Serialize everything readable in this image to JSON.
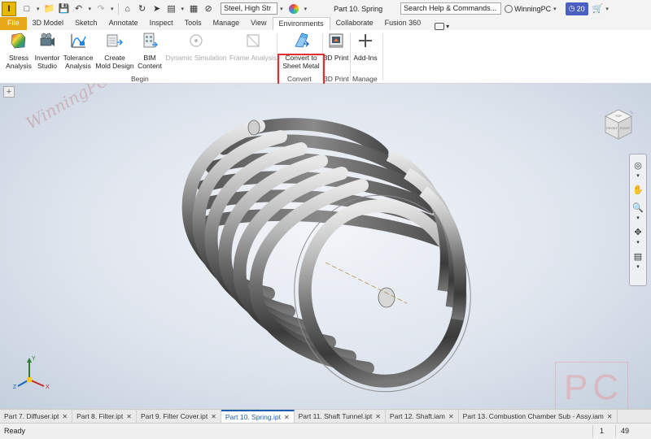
{
  "quick_access": {
    "material": "Steel, High Str",
    "document_title": "Part 10. Spring",
    "search_placeholder": "Search Help & Commands...",
    "user": "WinningPC",
    "clock_count": "20"
  },
  "tabs": [
    "File",
    "3D Model",
    "Sketch",
    "Annotate",
    "Inspect",
    "Tools",
    "Manage",
    "View",
    "Environments",
    "Collaborate",
    "Fusion 360"
  ],
  "active_tab": "Environments",
  "ribbon": {
    "stress_analysis": [
      "Stress",
      "Analysis"
    ],
    "inventor_studio": [
      "Inventor",
      "Studio"
    ],
    "tolerance_analysis": [
      "Tolerance",
      "Analysis"
    ],
    "create_mold_design": [
      "Create",
      "Mold Design"
    ],
    "bim_content": [
      "BIM",
      "Content"
    ],
    "dynamic_simulation": "Dynamic Simulation",
    "frame_analysis": "Frame Analysis",
    "convert_sheet_metal": [
      "Convert to",
      "Sheet Metal"
    ],
    "print_3d": "3D Print",
    "add_ins": "Add-Ins",
    "panels": {
      "begin": "Begin",
      "convert": "Convert",
      "print_3d": "3D Print",
      "manage": "Manage"
    }
  },
  "viewport": {
    "watermark": "WinningPC",
    "pc_logo": "PC",
    "viewcube_faces": [
      "TOP",
      "FRONT",
      "RIGHT"
    ],
    "triad_axes": [
      "X",
      "Y",
      "Z"
    ]
  },
  "document_tabs": [
    "Part 7. Diffuser.ipt",
    "Part 8. Filter.ipt",
    "Part 9. Filter Cover.ipt",
    "Part 10. Spring.ipt",
    "Part 11. Shaft Tunnel.ipt",
    "Part 12. Shaft.iam",
    "Part 13. Combustion Chamber Sub - Assy.iam"
  ],
  "active_document": "Part 10. Spring.ipt",
  "status": {
    "text": "Ready",
    "value1": "1",
    "value2": "49"
  },
  "colors": {
    "file_tab": "#e6a817",
    "highlight": "#e03030",
    "active_doc_tab": "#1a5fb4",
    "clock_badge": "#4a5fc1"
  }
}
